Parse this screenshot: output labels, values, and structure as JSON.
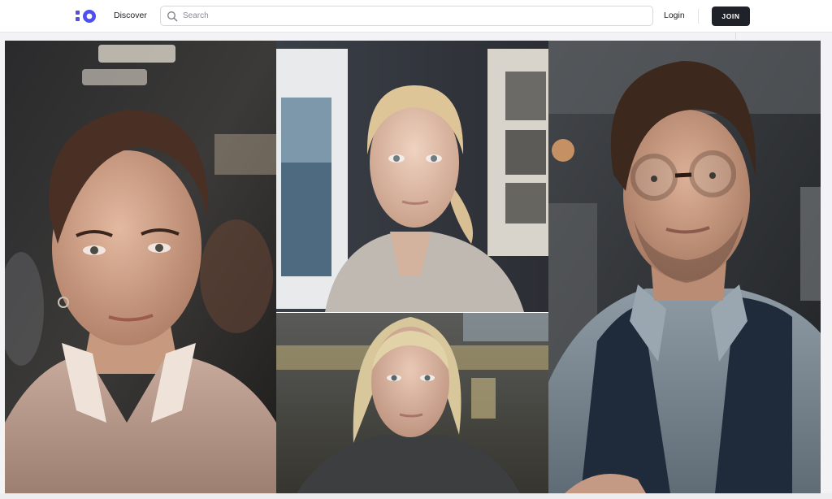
{
  "nav": {
    "discover_label": "Discover",
    "search_placeholder": "Search",
    "login_label": "Login",
    "join_label": "JOIN"
  },
  "icons": {
    "logo": "brand-logo-icon",
    "search": "search-icon"
  },
  "colors": {
    "brand": "#4f4ff0",
    "join_button_bg": "#1f2228"
  },
  "photos": [
    {
      "subject": "woman-short-brown-hair-blouse"
    },
    {
      "subject": "woman-blonde-ponytail-cardigan"
    },
    {
      "subject": "woman-blonde-dark-jacket"
    },
    {
      "subject": "man-glasses-vest-denim-shirt"
    }
  ]
}
